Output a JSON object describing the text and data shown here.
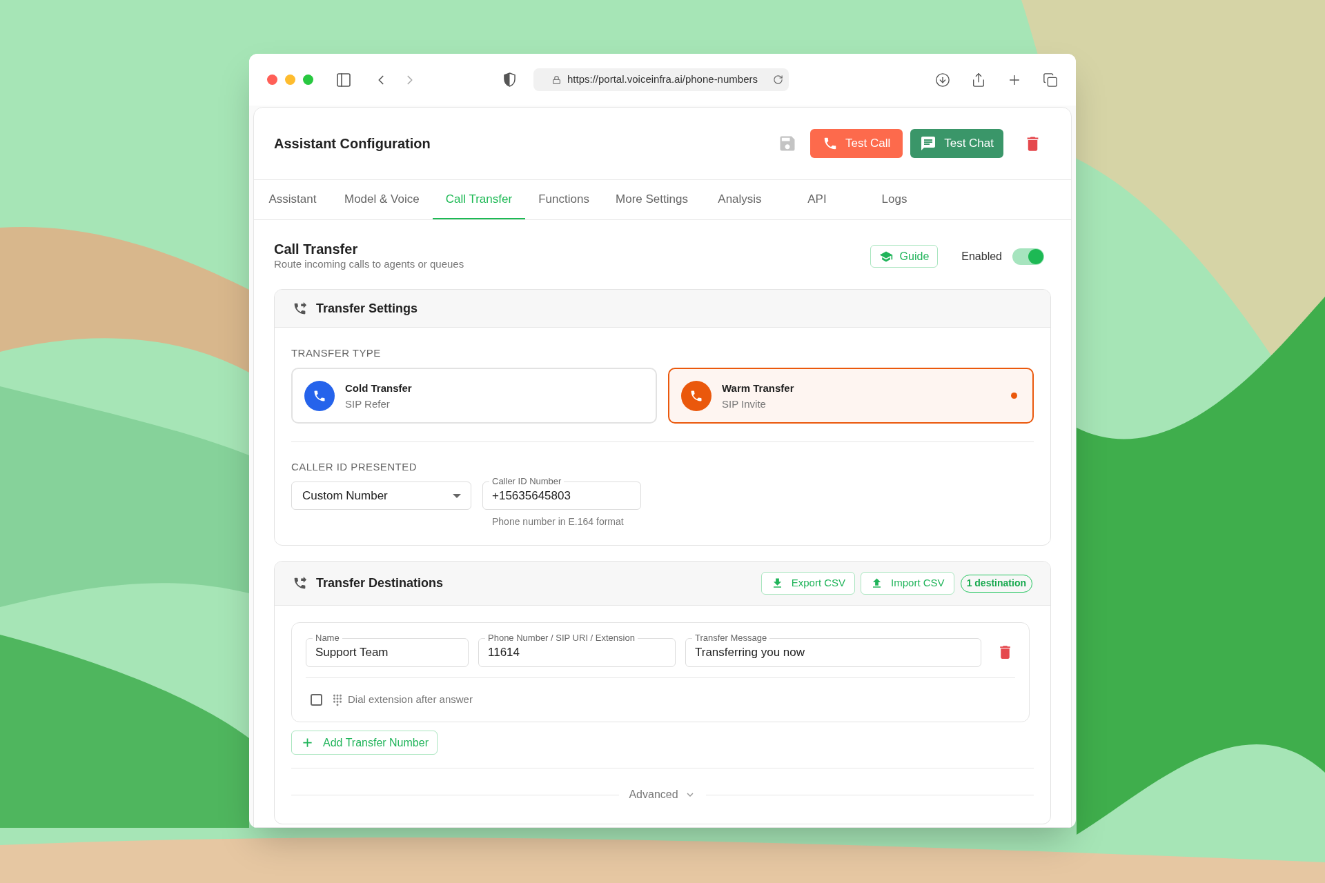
{
  "browser": {
    "url": "https://portal.voiceinfra.ai/phone-numbers"
  },
  "header": {
    "title": "Assistant Configuration",
    "actions": [
      {
        "label": "Test Call",
        "kind": "call"
      },
      {
        "label": "Test Chat",
        "kind": "chat"
      }
    ]
  },
  "tabs": [
    {
      "label": "Assistant",
      "selected": false
    },
    {
      "label": "Model & Voice",
      "selected": false
    },
    {
      "label": "Call Transfer",
      "selected": true
    },
    {
      "label": "Functions",
      "selected": false
    },
    {
      "label": "More Settings",
      "selected": false
    },
    {
      "label": "Analysis",
      "selected": false
    },
    {
      "label": "API",
      "selected": false
    },
    {
      "label": "Logs",
      "selected": false
    }
  ],
  "section": {
    "title": "Call Transfer",
    "subtitle": "Route incoming calls to agents or queues",
    "guide": "Guide",
    "enabled_label": "Enabled",
    "enabled": true
  },
  "transfer_settings": {
    "title": "Transfer Settings",
    "type_label": "TRANSFER TYPE",
    "types": [
      {
        "title": "Cold Transfer",
        "subtitle": "SIP Refer",
        "color": "#2563eb",
        "selected": false
      },
      {
        "title": "Warm Transfer",
        "subtitle": "SIP Invite",
        "color": "#ea580c",
        "selected": true
      }
    ],
    "caller_id_label": "CALLER ID PRESENTED",
    "caller_id_select": {
      "value": "Custom Number"
    },
    "caller_id_number": {
      "label": "Caller ID Number",
      "value": "+15635645803",
      "helper": "Phone number in E.164 format"
    }
  },
  "transfer_destinations": {
    "title": "Transfer Destinations",
    "buttons": [
      {
        "label": "Export CSV",
        "kind": "export"
      },
      {
        "label": "Import CSV",
        "kind": "import"
      }
    ],
    "count": "1 destination",
    "destinations": [
      {
        "fields": [
          {
            "label": "Name",
            "value": "Support Team"
          },
          {
            "label": "Phone Number / SIP URI / Extension",
            "value": "11614"
          },
          {
            "label": "Transfer Message",
            "value": "Transferring you now"
          }
        ],
        "dial_extension": {
          "label": "Dial extension after answer",
          "checked": false
        }
      }
    ],
    "add_button": "Add Transfer Number",
    "advanced": "Advanced"
  }
}
